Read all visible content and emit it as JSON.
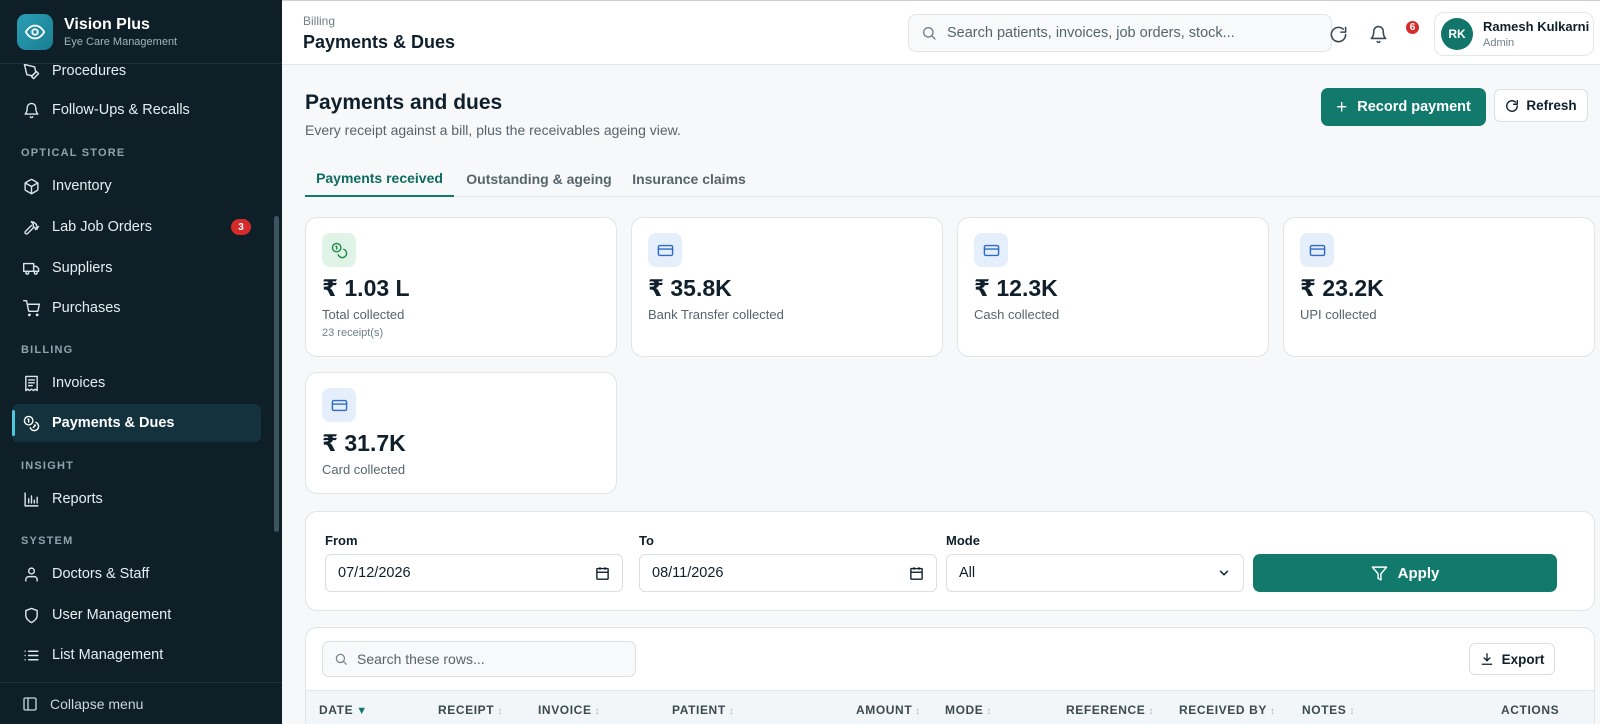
{
  "brand": {
    "name": "Vision Plus",
    "subtitle": "Eye Care Management"
  },
  "sidebar": {
    "items": [
      {
        "label": "Procedures",
        "icon": "pen-tool-icon"
      },
      {
        "label": "Follow-Ups & Recalls",
        "icon": "bell-icon"
      },
      {
        "label": "Inventory",
        "icon": "box-icon"
      },
      {
        "label": "Lab Job Orders",
        "icon": "hammer-icon",
        "badge": "3"
      },
      {
        "label": "Suppliers",
        "icon": "truck-icon"
      },
      {
        "label": "Purchases",
        "icon": "cart-icon"
      },
      {
        "label": "Invoices",
        "icon": "receipt-icon"
      },
      {
        "label": "Payments & Dues",
        "icon": "coins-icon",
        "active": true
      },
      {
        "label": "Reports",
        "icon": "bar-chart-icon"
      },
      {
        "label": "Doctors & Staff",
        "icon": "user-icon"
      },
      {
        "label": "User Management",
        "icon": "shield-icon"
      },
      {
        "label": "List Management",
        "icon": "list-icon"
      }
    ],
    "sections": [
      "OPTICAL STORE",
      "BILLING",
      "INSIGHT",
      "SYSTEM"
    ],
    "collapse_label": "Collapse menu"
  },
  "topbar": {
    "breadcrumb": "Billing",
    "title": "Payments & Dues",
    "search_placeholder": "Search patients, invoices, job orders, stock...",
    "notification_count": "6",
    "user": {
      "initials": "RK",
      "name": "Ramesh Kulkarni",
      "role": "Admin"
    }
  },
  "page": {
    "title": "Payments and dues",
    "subtitle": "Every receipt against a bill, plus the receivables ageing view.",
    "record_payment_label": "Record payment",
    "refresh_label": "Refresh"
  },
  "tabs": [
    {
      "label": "Payments received",
      "active": true
    },
    {
      "label": "Outstanding & ageing"
    },
    {
      "label": "Insurance claims"
    }
  ],
  "stats": [
    {
      "value": "₹ 1.03 L",
      "label": "Total collected",
      "sub": "23 receipt(s)"
    },
    {
      "value": "₹ 35.8K",
      "label": "Bank Transfer collected"
    },
    {
      "value": "₹ 12.3K",
      "label": "Cash collected"
    },
    {
      "value": "₹ 23.2K",
      "label": "UPI collected"
    },
    {
      "value": "₹ 31.7K",
      "label": "Card collected"
    }
  ],
  "filters": {
    "from_label": "From",
    "from_value": "07/12/2026",
    "to_label": "To",
    "to_value": "08/11/2026",
    "mode_label": "Mode",
    "mode_value": "All",
    "apply_label": "Apply"
  },
  "table": {
    "search_placeholder": "Search these rows...",
    "export_label": "Export",
    "columns": [
      "DATE",
      "RECEIPT",
      "INVOICE",
      "PATIENT",
      "AMOUNT",
      "MODE",
      "REFERENCE",
      "RECEIVED BY",
      "NOTES",
      "ACTIONS"
    ]
  },
  "colors": {
    "sidebar_bg": "#0e1f27",
    "accent": "#127a6c",
    "badge": "#d62b2b"
  }
}
